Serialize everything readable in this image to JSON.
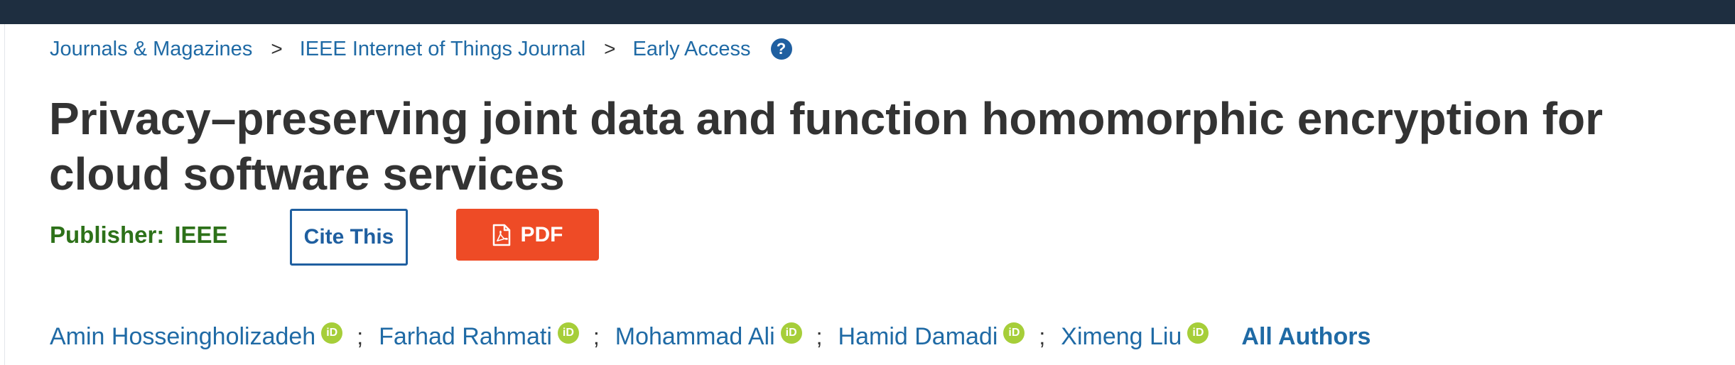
{
  "breadcrumb": {
    "items": [
      "Journals & Magazines",
      "IEEE Internet of Things Journal",
      "Early Access"
    ],
    "separator": ">"
  },
  "help_icon": {
    "glyph": "?",
    "name": "help-icon"
  },
  "article": {
    "title": "Privacy–preserving joint data and function homomorphic encryption for cloud software services"
  },
  "publisher": {
    "label": "Publisher:",
    "value": "IEEE"
  },
  "actions": {
    "cite_label": "Cite This",
    "pdf_label": "PDF"
  },
  "authors": {
    "list": [
      "Amin Hosseingholizadeh",
      "Farhad Rahmati",
      "Mohammad Ali",
      "Hamid Damadi",
      "Ximeng Liu"
    ],
    "separator": ";",
    "orcid_glyph": "iD",
    "all_authors_label": "All Authors"
  },
  "colors": {
    "top_bar": "#1e2e40",
    "link": "#1f6aa5",
    "publisher_green": "#2d7119",
    "pdf_orange": "#ee4b26",
    "orcid_green": "#a6ce39"
  }
}
